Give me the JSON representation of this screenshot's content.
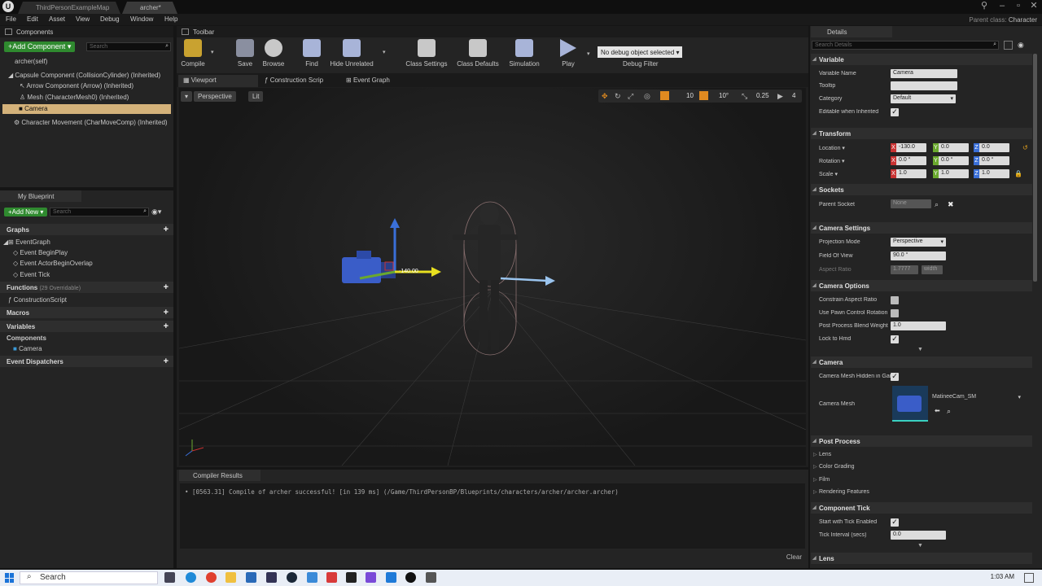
{
  "window": {
    "tabs": [
      "ThirdPersonExampleMap",
      "archer*"
    ],
    "parent_class_label": "Parent class:",
    "parent_class_value": "Character"
  },
  "menu": [
    "File",
    "Edit",
    "Asset",
    "View",
    "Debug",
    "Window",
    "Help"
  ],
  "components_panel": {
    "title": "Components",
    "add_button": "+Add Component",
    "add_button_arrow": "▾",
    "search_placeholder": "Search",
    "self_item": "archer(self)",
    "items": [
      "Capsule Component (CollisionCylinder) (Inherited)",
      "Arrow Component (Arrow) (Inherited)",
      "Mesh (CharacterMesh0) (Inherited)",
      "Camera",
      "Character Movement (CharMoveComp) (Inherited)"
    ]
  },
  "my_blueprint": {
    "title": "My Blueprint",
    "add_new": "+Add New",
    "add_new_arrow": "▾",
    "search_placeholder": "Search",
    "graphs_label": "Graphs",
    "event_graph": "EventGraph",
    "events": [
      "Event BeginPlay",
      "Event ActorBeginOverlap",
      "Event Tick"
    ],
    "functions_label": "Functions",
    "functions_count": "(29 Overridable)",
    "construction_script": "ConstructionScript",
    "macros_label": "Macros",
    "variables_label": "Variables",
    "components_label": "Components",
    "component_item": "Camera",
    "dispatchers_label": "Event Dispatchers"
  },
  "toolbar": {
    "title": "Toolbar",
    "buttons": [
      "Compile",
      "Save",
      "Browse",
      "Find",
      "Hide Unrelated",
      "Class Settings",
      "Class Defaults",
      "Simulation",
      "Play"
    ],
    "debug_object": "No debug object selected",
    "debug_filter": "Debug Filter"
  },
  "viewport": {
    "tabs": [
      "Viewport",
      "Construction Scrip",
      "Event Graph"
    ],
    "perspective_btn": "Perspective",
    "lit_btn": "Lit",
    "snap_grid": "10",
    "snap_rotation": "10°",
    "snap_scale": "0.25",
    "camera_speed": "4",
    "gizmo_readout": "-140.00"
  },
  "compiler": {
    "title": "Compiler Results",
    "message": "[0563.31] Compile of archer successful! [in 139 ms] (/Game/ThirdPersonBP/Blueprints/characters/archer/archer.archer)",
    "clear": "Clear"
  },
  "details": {
    "title": "Details",
    "search_placeholder": "Search Details",
    "variable": {
      "header": "Variable",
      "name_label": "Variable Name",
      "name_value": "Camera",
      "tooltip_label": "Tooltip",
      "category_label": "Category",
      "category_value": "Default",
      "editable_label": "Editable when Inherited"
    },
    "transform": {
      "header": "Transform",
      "location_label": "Location ▾",
      "rotation_label": "Rotation ▾",
      "scale_label": "Scale ▾",
      "location": [
        "-130.0",
        "0.0",
        "0.0"
      ],
      "rotation": [
        "0.0 °",
        "0.0 °",
        "0.0 °"
      ],
      "scale": [
        "1.0",
        "1.0",
        "1.0"
      ]
    },
    "sockets": {
      "header": "Sockets",
      "parent_socket_label": "Parent Socket",
      "parent_socket_value": "None"
    },
    "camera_settings": {
      "header": "Camera Settings",
      "projection_label": "Projection Mode",
      "projection_value": "Perspective",
      "fov_label": "Field Of View",
      "fov_value": "90.0 °",
      "aspect_label": "Aspect Ratio",
      "aspect_value": "1.7777",
      "aspect_value2": "width"
    },
    "camera_options": {
      "header": "Camera Options",
      "constrain_label": "Constrain Aspect Ratio",
      "pawn_label": "Use Pawn Control Rotation",
      "blend_label": "Post Process Blend Weight",
      "blend_value": "1.0",
      "hmd_label": "Lock to Hmd"
    },
    "camera": {
      "header": "Camera",
      "hidden_label": "Camera Mesh Hidden in Game",
      "mesh_label": "Camera Mesh",
      "mesh_value": "MatineeCam_SM"
    },
    "post_process": {
      "header": "Post Process",
      "items": [
        "Lens",
        "Color Grading",
        "Film",
        "Rendering Features"
      ]
    },
    "component_tick": {
      "header": "Component Tick",
      "start_label": "Start with Tick Enabled",
      "interval_label": "Tick Interval (secs)",
      "interval_value": "0.0"
    },
    "lens_header": "Lens"
  },
  "taskbar": {
    "search": "Search",
    "time": "1:03 AM"
  },
  "colors": {
    "accent_green": "#2f8a2f",
    "selection": "#d4b27a",
    "axis_x": "#c83232",
    "axis_y": "#6aa82e",
    "axis_z": "#3a6fd8"
  }
}
